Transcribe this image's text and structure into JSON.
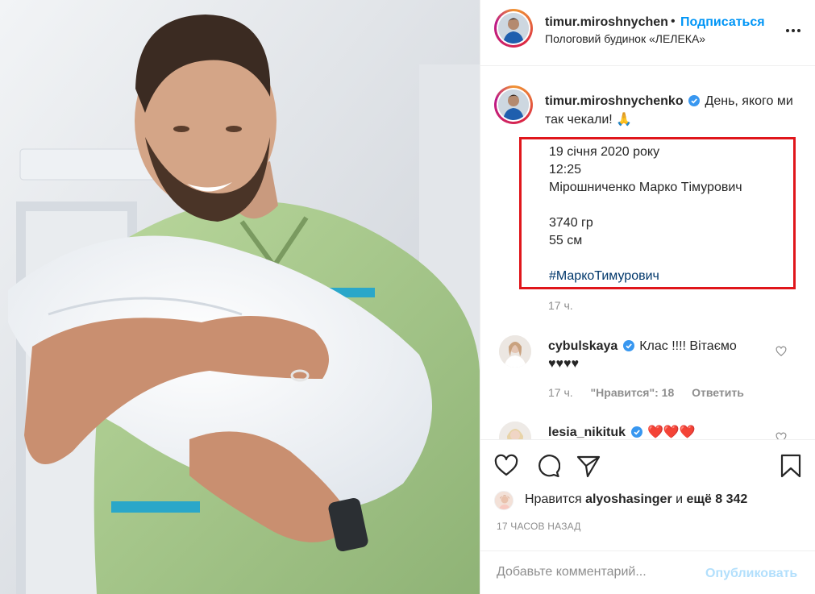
{
  "header": {
    "username": "timur.miroshnychenko",
    "dot": "•",
    "follow_label": "Подписаться",
    "location": "Пологовий будинок «ЛЕЛЕКА»",
    "more_icon": "more-dots-icon"
  },
  "caption": {
    "username": "timur.miroshnychenko",
    "verified_icon": "verified-badge-icon",
    "text": "День, якого ми так чекали! 🙏",
    "lines": [
      "19 січня 2020 року",
      "12:25",
      "Мірошниченко Марко Тімурович",
      "",
      "3740 гр",
      "55 см",
      ""
    ],
    "hashtag": "#МаркоТимурович",
    "time": "17 ч."
  },
  "comments": [
    {
      "username": "cybulskaya",
      "text": "Клас !!!! Вітаємо ♥♥♥♥",
      "time": "17 ч.",
      "likes": "\"Нравится\": 18",
      "reply": "Ответить"
    },
    {
      "username": "lesia_nikituk",
      "text": "❤️❤️❤️"
    }
  ],
  "actions": {
    "like_icon": "heart-icon",
    "comment_icon": "comment-icon",
    "share_icon": "paper-plane-icon",
    "save_icon": "bookmark-icon"
  },
  "likes": {
    "prefix": "Нравится",
    "user": "alyoshasinger",
    "middle": "и",
    "count": "ещё 8 342"
  },
  "posted_ago": "17 ЧАСОВ НАЗАД",
  "add_comment": {
    "placeholder": "Добавьте комментарий...",
    "publish_label": "Опубликовать"
  },
  "colors": {
    "link_blue": "#0095f6",
    "highlight_border": "#e0161b",
    "publish_disabled": "#b2dffc",
    "muted": "#8e8e8e"
  }
}
